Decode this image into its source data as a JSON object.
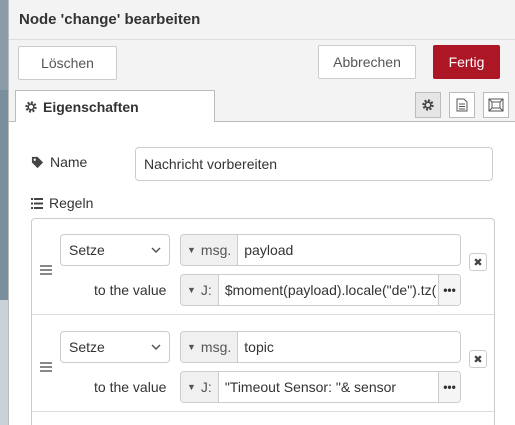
{
  "dialog": {
    "title": "Node 'change' bearbeiten"
  },
  "toolbar": {
    "delete_label": "Löschen",
    "cancel_label": "Abbrechen",
    "done_label": "Fertig"
  },
  "tabs": {
    "properties_label": "Eigenschaften",
    "icons": [
      "gear-icon",
      "description-icon",
      "appearance-icon"
    ]
  },
  "form": {
    "name_label": "Name",
    "name_value": "Nachricht vorbereiten",
    "rules_label": "Regeln"
  },
  "rules": [
    {
      "action": "Setze",
      "property_prefix": "msg.",
      "property": "payload",
      "to_label": "to the value",
      "value_type_icon": "J:",
      "value": "$moment(payload).locale(\"de\").tz("
    },
    {
      "action": "Setze",
      "property_prefix": "msg.",
      "property": "topic",
      "to_label": "to the value",
      "value_type_icon": "J:",
      "value": "\"Timeout Sensor: \"& sensor"
    }
  ],
  "colors": {
    "primary_button": "#ad1625",
    "header_background": "#f3f3f3",
    "border": "#cccccc"
  }
}
